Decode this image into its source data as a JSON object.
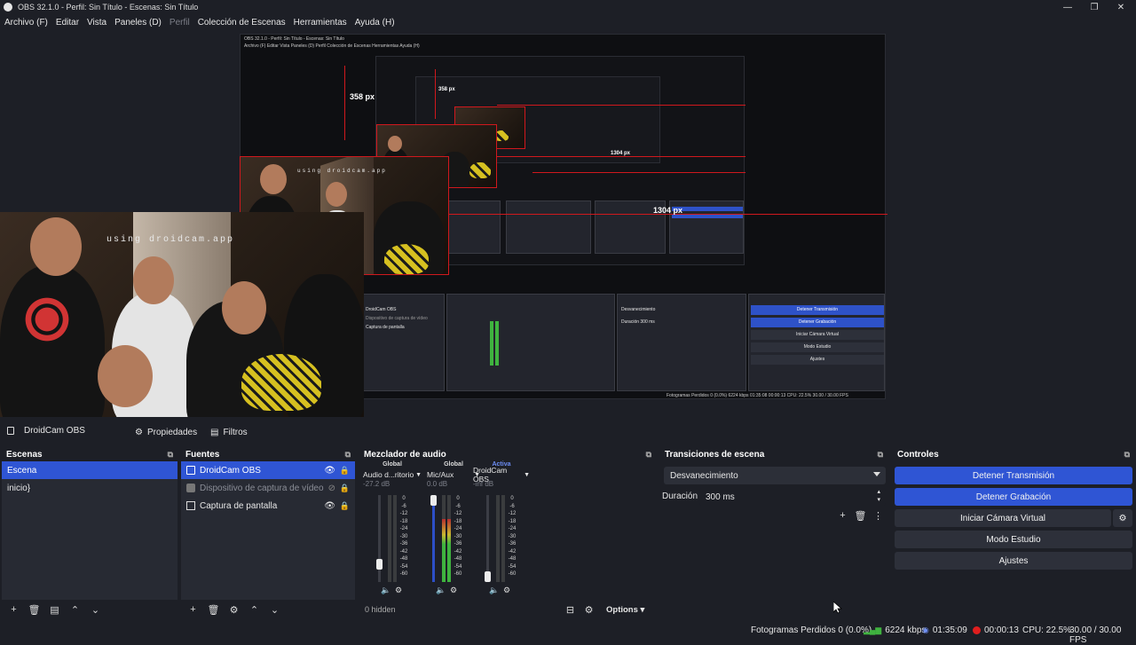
{
  "window": {
    "title": "OBS 32.1.0 - Perfil: Sin Título - Escenas: Sin Título",
    "minimize_glyph": "—",
    "maximize_glyph": "❐",
    "close_glyph": "✕"
  },
  "menu": [
    "Archivo (F)",
    "Editar",
    "Vista",
    "Paneles (D)",
    "Perfil",
    "Colección de Escenas",
    "Herramientas",
    "Ayuda (H)"
  ],
  "menu_disabled_index": 4,
  "preview": {
    "nested_title": "OBS 32.1.0 - Perfil: Sin Título - Escenas: Sin Título",
    "nested_menu": "Archivo (F)   Editar   Vista   Paneles (D)   Perfil   Colección de Escenas   Herramientas   Ayuda (H)",
    "camera_caption": "using droidcam.app",
    "dimension_label_1": "358 px",
    "dimension_label_2": "358 px",
    "dimension_label_3": "1304 px",
    "dimension_label_4": "1304 px",
    "nested_controls": [
      "Detener Transmisión",
      "Detener Grabación",
      "Iniciar Cámara Virtual",
      "Modo Estudio",
      "Ajustes"
    ],
    "nested_transition": "Desvanecimiento",
    "nested_duration": "Duración   300 ms",
    "nested_status": "Fotogramas Perdidos 0 (0.0%)   6224 kbps   01:35:08   00:00:13   CPU: 22.5%   30.00 / 30.00 FPS",
    "nested_sources": [
      "DroidCam OBS",
      "Dispositivo de captura de vídeo",
      "Captura de pantalla"
    ]
  },
  "source_toolbar": {
    "source_name": "DroidCam OBS",
    "properties_label": "Propiedades",
    "filters_label": "Filtros"
  },
  "scenes": {
    "title": "Escenas",
    "items": [
      {
        "label": "Escena",
        "selected": true
      },
      {
        "label": "inicio}",
        "selected": false
      }
    ]
  },
  "sources": {
    "title": "Fuentes",
    "items": [
      {
        "label": "DroidCam OBS",
        "selected": true,
        "visible": true,
        "icon": "window-icon"
      },
      {
        "label": "Dispositivo de captura de vídeo",
        "selected": false,
        "visible": false,
        "icon": "camera-icon"
      },
      {
        "label": "Captura de pantalla",
        "selected": false,
        "visible": true,
        "icon": "monitor-icon"
      }
    ]
  },
  "mixer": {
    "title": "Mezclador de audio",
    "channels": [
      {
        "global": "Global",
        "name": "Audio d...ritorio",
        "db": "-27.2 dB",
        "level": 0.0,
        "fader": 0.3
      },
      {
        "global": "Global",
        "name": "Mic/Aux",
        "db": "0.0 dB",
        "level": 0.72,
        "fader": 0.95
      },
      {
        "global": "Activa",
        "name": "DroidCam OBS",
        "db": "-inf dB",
        "level": 0.0,
        "fader": 0.05
      }
    ],
    "scale": [
      "0",
      "-6",
      "-12",
      "-18",
      "-24",
      "-30",
      "-36",
      "-42",
      "-48",
      "-54",
      "-60"
    ],
    "hidden_label": "0 hidden",
    "options_label": "Options"
  },
  "transitions": {
    "title": "Transiciones de escena",
    "selected": "Desvanecimiento",
    "duration_label": "Duración",
    "duration_value": "300 ms"
  },
  "controls": {
    "title": "Controles",
    "buttons": [
      {
        "label": "Detener Transmisión",
        "active": true
      },
      {
        "label": "Detener Grabación",
        "active": true
      },
      {
        "label": "Iniciar Cámara Virtual",
        "active": false
      },
      {
        "label": "Modo Estudio",
        "active": false
      },
      {
        "label": "Ajustes",
        "active": false
      }
    ]
  },
  "status": {
    "dropped_frames": "Fotogramas Perdidos 0 (0.0%)",
    "bitrate": "6224 kbps",
    "stream_time": "01:35:09",
    "rec_time": "00:00:13",
    "cpu": "CPU: 22.5%",
    "fps": "30.00 / 30.00 FPS"
  },
  "colors": {
    "accent": "#2f55d4",
    "background": "#1d1f26",
    "panel": "#272a33",
    "red_guide": "#d0181d",
    "recording_dot": "#e01e1e"
  }
}
